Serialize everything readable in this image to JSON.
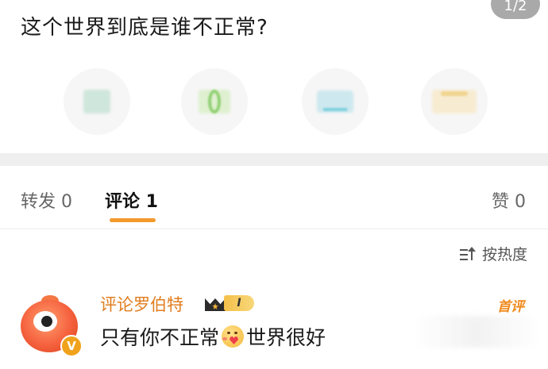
{
  "post": {
    "title": "这个世界到底是谁不正常?",
    "page_indicator": "1/2"
  },
  "reactions": [
    {
      "icon": "reaction-1-icon"
    },
    {
      "icon": "reaction-2-icon"
    },
    {
      "icon": "reaction-3-icon"
    },
    {
      "icon": "reaction-4-icon"
    }
  ],
  "tabs": {
    "repost": "转发 0",
    "comment": "评论 1",
    "like": "赞 0",
    "active": "comment"
  },
  "sort": {
    "label": "按热度",
    "icon": "sort-icon"
  },
  "comments": [
    {
      "username": "评论罗伯特",
      "level": "I",
      "tag": "首评",
      "text_before": "只有你不正常",
      "emoji": "heart-kiss-emoji-icon",
      "text_after": "世界很好",
      "avatar_badge": "V"
    }
  ],
  "colors": {
    "accent": "#f39a2e",
    "username": "#e07d1f",
    "first_tag": "#f08a1c"
  }
}
